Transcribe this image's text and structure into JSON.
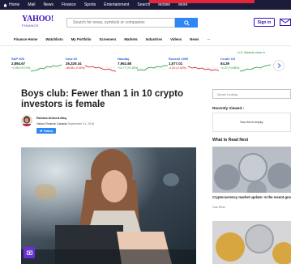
{
  "topnav": {
    "items": [
      "Home",
      "Mail",
      "News",
      "Finance",
      "Sports",
      "Entertainment",
      "Search",
      "Mobile",
      "More"
    ]
  },
  "header": {
    "logo_main": "YAHOO!",
    "logo_sub": "FINANCE",
    "search_placeholder": "Search for news, symbols or companies",
    "signin_label": "Sign in"
  },
  "subnav": {
    "items": [
      "Finance Home",
      "Watchlists",
      "My Portfolio",
      "Screeners",
      "Markets",
      "Industries",
      "Videos",
      "News",
      "···"
    ]
  },
  "market_status": "U.S. Markets close in",
  "tickers": [
    {
      "name": "S&P 500",
      "value": "2,894.67",
      "change": "+1.98 (+0.07%)",
      "trend": "up"
    },
    {
      "name": "Dow 30",
      "value": "26,329.34",
      "change": "-86.85 (-0.33%)",
      "trend": "down"
    },
    {
      "name": "Nasdaq",
      "value": "7,962.88",
      "change": "+14.77 (+0.18%)",
      "trend": "up"
    },
    {
      "name": "Russell 2000",
      "value": "1,577.01",
      "change": "-0.03 (-0.00%)",
      "trend": "down"
    },
    {
      "name": "Crude Oil",
      "value": "84.39",
      "change": "+1.37 (+0.68%)",
      "trend": "up"
    }
  ],
  "article": {
    "headline": "Boys club: Fewer than 1 in 10 crypto investors is female",
    "author": "Rubina Ahmed-Haq",
    "publisher": "Yahoo Finance Canada",
    "date": "September 21, 2018",
    "follow_label": "Follow"
  },
  "sidebar": {
    "quote_placeholder": "Quote Lookup",
    "recently_viewed_title": "Recently Viewed ›",
    "recently_viewed_empty": "Your list is empty.",
    "what_to_read_title": "What to Read Next",
    "stories": [
      {
        "title": "Cryptocurrency market update: Is the recent growth sustainable?",
        "source": "Coin Rivet"
      }
    ]
  },
  "colors": {
    "brand": "#3b0fb5",
    "accent": "#2f86f6",
    "up": "#1b8f3a",
    "down": "#d0021b"
  }
}
